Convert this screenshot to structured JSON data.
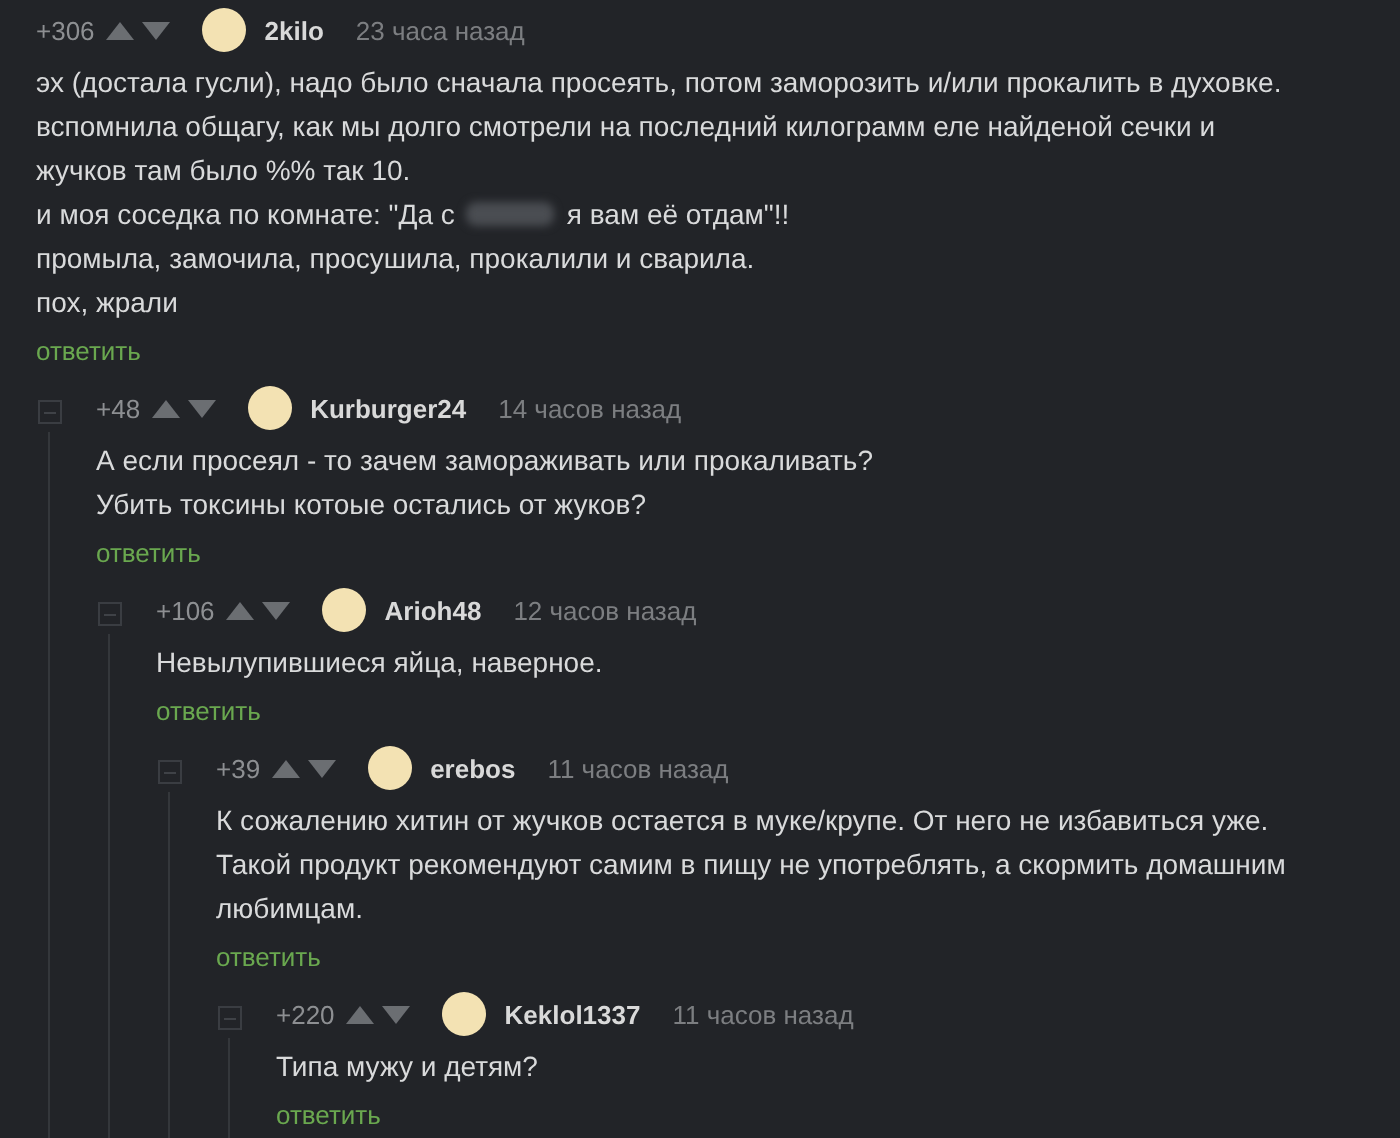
{
  "comments": [
    {
      "rating": "+306",
      "author": "2kilo",
      "time": "23 часа назад",
      "lines": [
        {
          "kind": "plain",
          "text": "эх (достала гусли), надо было сначала просеять, потом заморозить и/или прокалить в духовке."
        },
        {
          "kind": "plain",
          "text": "вспомнила общагу, как мы долго смотрели на последний килограмм еле найденой сечки и"
        },
        {
          "kind": "plain",
          "text": "жучков там было %% так 10."
        },
        {
          "kind": "spoiler",
          "before": "и моя соседка по комнате: \"Да с",
          "after": "я вам её отдам\"!!"
        },
        {
          "kind": "plain",
          "text": "промыла, замочила, просушила, прокалили и сварила."
        },
        {
          "kind": "plain",
          "text": "пох, жрали"
        }
      ],
      "reply": "ответить",
      "children": [
        {
          "rating": "+48",
          "author": "Kurburger24",
          "time": "14 часов назад",
          "lines": [
            {
              "kind": "plain",
              "text": "А если просеял - то зачем замораживать или прокаливать?"
            },
            {
              "kind": "plain",
              "text": "Убить токсины котоые остались от жуков?"
            }
          ],
          "reply": "ответить",
          "children": [
            {
              "rating": "+106",
              "author": "Arioh48",
              "time": "12 часов назад",
              "lines": [
                {
                  "kind": "plain",
                  "text": "Невылупившиеся яйца, наверное."
                }
              ],
              "reply": "ответить",
              "children": [
                {
                  "rating": "+39",
                  "author": "erebos",
                  "time": "11 часов назад",
                  "lines": [
                    {
                      "kind": "plain",
                      "text": "К сожалению хитин от жучков остается в муке/крупе. От него не избавиться уже."
                    },
                    {
                      "kind": "plain",
                      "text": "Такой продукт рекомендуют самим в пищу не употреблять, а скормить домашним"
                    },
                    {
                      "kind": "plain",
                      "text": "любимцам."
                    }
                  ],
                  "reply": "ответить",
                  "children": [
                    {
                      "rating": "+220",
                      "author": "Keklol1337",
                      "time": "11 часов назад",
                      "lines": [
                        {
                          "kind": "plain",
                          "text": "Типа мужу и детям?"
                        }
                      ],
                      "reply": "ответить"
                    }
                  ]
                }
              ]
            }
          ]
        }
      ]
    }
  ]
}
